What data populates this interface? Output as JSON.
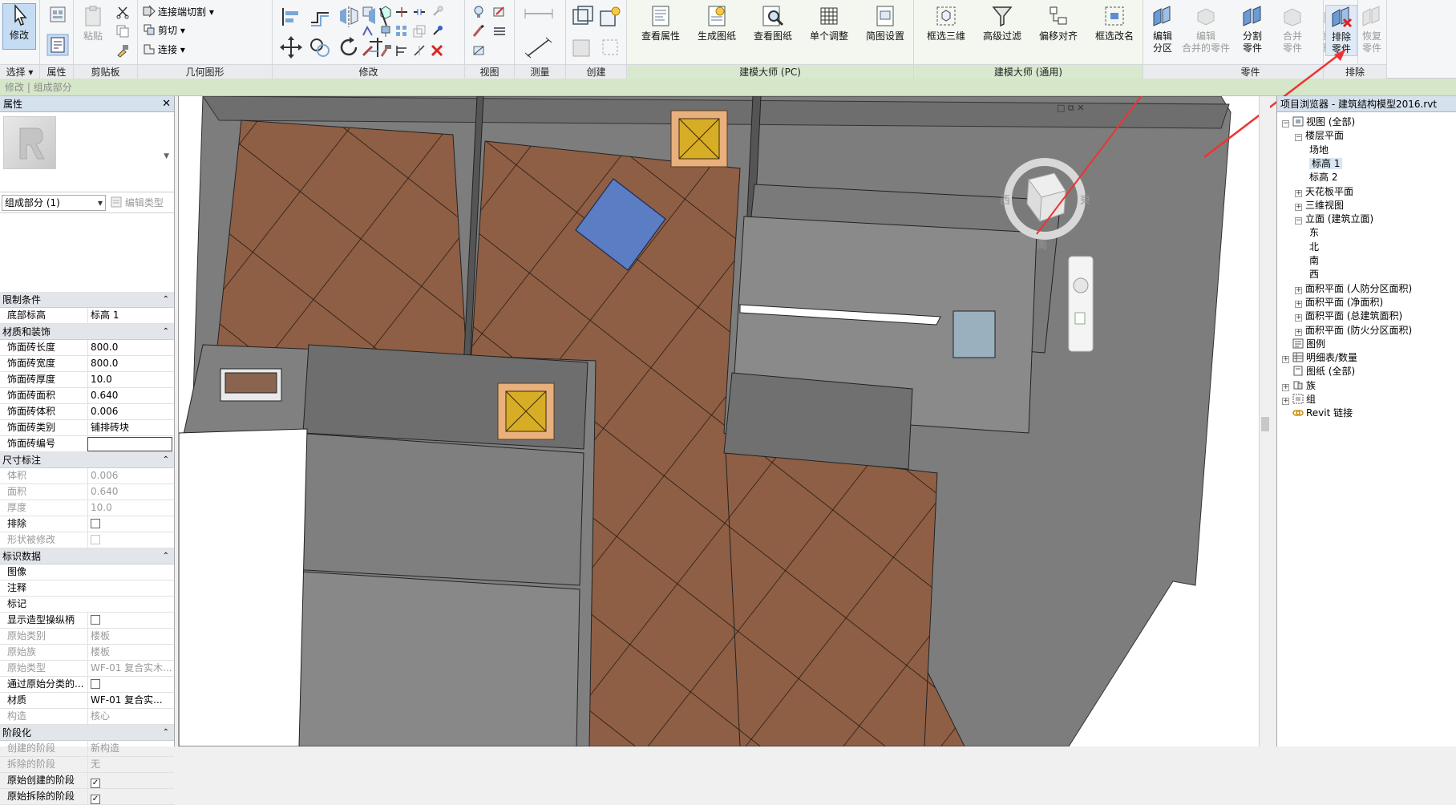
{
  "ribbon": {
    "select": {
      "button": "修改",
      "title": "选择"
    },
    "properties": {
      "title": "属性"
    },
    "clipboard": {
      "paste": "粘贴",
      "title": "剪贴板"
    },
    "geometry": {
      "join_cut": "连接端切割",
      "cut": "剪切",
      "join": "连接",
      "title": "几何图形"
    },
    "modify": {
      "title": "修改"
    },
    "view": {
      "title": "视图"
    },
    "measure": {
      "title": "测量"
    },
    "create": {
      "title": "创建"
    },
    "pc_master": {
      "title": "建模大师 (PC)",
      "buttons": [
        "查看属性",
        "生成图纸",
        "查看图纸",
        "单个调整",
        "简图设置"
      ]
    },
    "general_master": {
      "title": "建模大师 (通用)",
      "buttons": [
        "框选三维",
        "高级过滤",
        "偏移对齐",
        "框选改名"
      ]
    },
    "parts": {
      "title": "零件",
      "buttons": [
        {
          "l1": "编辑",
          "l2": "分区",
          "enabled": true
        },
        {
          "l1": "编辑",
          "l2": "合并的零件",
          "enabled": false
        },
        {
          "l1": "分割",
          "l2": "零件",
          "enabled": true
        },
        {
          "l1": "合并",
          "l2": "零件",
          "enabled": false
        },
        {
          "l1": "重设",
          "l2": "形状",
          "enabled": false
        }
      ]
    },
    "exclude": {
      "title": "排除",
      "buttons": [
        {
          "l1": "排除",
          "l2": "零件",
          "enabled": true
        },
        {
          "l1": "恢复",
          "l2": "零件",
          "enabled": false
        }
      ]
    }
  },
  "optionsbar": {
    "text": "修改 | 组成部分"
  },
  "properties": {
    "title": "属性",
    "close": "✕",
    "type_selector": "组成部分 (1)",
    "edit_type": "编辑类型",
    "sections": [
      {
        "title": "限制条件",
        "rows": [
          {
            "k": "底部标高",
            "v": "标高 1",
            "dim": false
          }
        ]
      },
      {
        "title": "材质和装饰",
        "rows": [
          {
            "k": "饰面砖长度",
            "v": "800.0",
            "dim": false
          },
          {
            "k": "饰面砖宽度",
            "v": "800.0",
            "dim": false
          },
          {
            "k": "饰面砖厚度",
            "v": "10.0",
            "dim": false
          },
          {
            "k": "饰面砖面积",
            "v": "0.640",
            "dim": false
          },
          {
            "k": "饰面砖体积",
            "v": "0.006",
            "dim": false
          },
          {
            "k": "饰面砖类别",
            "v": "铺排砖块",
            "dim": false
          },
          {
            "k": "饰面砖编号",
            "v": "",
            "dim": false,
            "boxed": true
          }
        ]
      },
      {
        "title": "尺寸标注",
        "rows": [
          {
            "k": "体积",
            "v": "0.006",
            "dim": true
          },
          {
            "k": "面积",
            "v": "0.640",
            "dim": true
          },
          {
            "k": "厚度",
            "v": "10.0",
            "dim": true
          },
          {
            "k": "排除",
            "v": "",
            "dim": false,
            "check": "off"
          },
          {
            "k": "形状被修改",
            "v": "",
            "dim": true,
            "check": "dis"
          }
        ]
      },
      {
        "title": "标识数据",
        "rows": [
          {
            "k": "图像",
            "v": "",
            "dim": false
          },
          {
            "k": "注释",
            "v": "",
            "dim": false
          },
          {
            "k": "标记",
            "v": "",
            "dim": false
          },
          {
            "k": "显示造型操纵柄",
            "v": "",
            "dim": false,
            "check": "off"
          },
          {
            "k": "原始类别",
            "v": "楼板",
            "dim": true
          },
          {
            "k": "原始族",
            "v": "楼板",
            "dim": true
          },
          {
            "k": "原始类型",
            "v": "WF-01 复合实木...",
            "dim": true
          },
          {
            "k": "通过原始分类的...",
            "v": "",
            "dim": false,
            "check": "off"
          },
          {
            "k": "材质",
            "v": "WF-01 复合实...",
            "dim": false
          },
          {
            "k": "构造",
            "v": "核心",
            "dim": true
          }
        ]
      },
      {
        "title": "阶段化",
        "rows": [
          {
            "k": "创建的阶段",
            "v": "新构造",
            "dim": true
          },
          {
            "k": "拆除的阶段",
            "v": "无",
            "dim": true
          },
          {
            "k": "原始创建的阶段",
            "v": "",
            "dim": false,
            "check": "on"
          },
          {
            "k": "原始拆除的阶段",
            "v": "",
            "dim": false,
            "check": "on"
          }
        ]
      }
    ]
  },
  "viewcube": {
    "west": "西",
    "east": "東",
    "south": "南"
  },
  "browser": {
    "title": "项目浏览器 - 建筑结构模型2016.rvt",
    "close": "✕",
    "nodes": [
      {
        "label": "视图 (全部)",
        "depth": 0,
        "toggle": "−",
        "icon": "views"
      },
      {
        "label": "楼层平面",
        "depth": 1,
        "toggle": "−"
      },
      {
        "label": "场地",
        "depth": 2
      },
      {
        "label": "标高 1",
        "depth": 2,
        "selected": true
      },
      {
        "label": "标高 2",
        "depth": 2
      },
      {
        "label": "天花板平面",
        "depth": 1,
        "toggle": "+"
      },
      {
        "label": "三维视图",
        "depth": 1,
        "toggle": "+"
      },
      {
        "label": "立面 (建筑立面)",
        "depth": 1,
        "toggle": "−"
      },
      {
        "label": "东",
        "depth": 2
      },
      {
        "label": "北",
        "depth": 2
      },
      {
        "label": "南",
        "depth": 2
      },
      {
        "label": "西",
        "depth": 2
      },
      {
        "label": "面积平面 (人防分区面积)",
        "depth": 1,
        "toggle": "+"
      },
      {
        "label": "面积平面 (净面积)",
        "depth": 1,
        "toggle": "+"
      },
      {
        "label": "面积平面 (总建筑面积)",
        "depth": 1,
        "toggle": "+"
      },
      {
        "label": "面积平面 (防火分区面积)",
        "depth": 1,
        "toggle": "+"
      },
      {
        "label": "图例",
        "depth": 0,
        "icon": "legend"
      },
      {
        "label": "明细表/数量",
        "depth": 0,
        "toggle": "+",
        "icon": "sched"
      },
      {
        "label": "图纸 (全部)",
        "depth": 0,
        "icon": "sheet"
      },
      {
        "label": "族",
        "depth": 0,
        "toggle": "+",
        "icon": "fam"
      },
      {
        "label": "组",
        "depth": 0,
        "toggle": "+",
        "icon": "grp"
      },
      {
        "label": "Revit 链接",
        "depth": 0,
        "icon": "link"
      }
    ]
  }
}
